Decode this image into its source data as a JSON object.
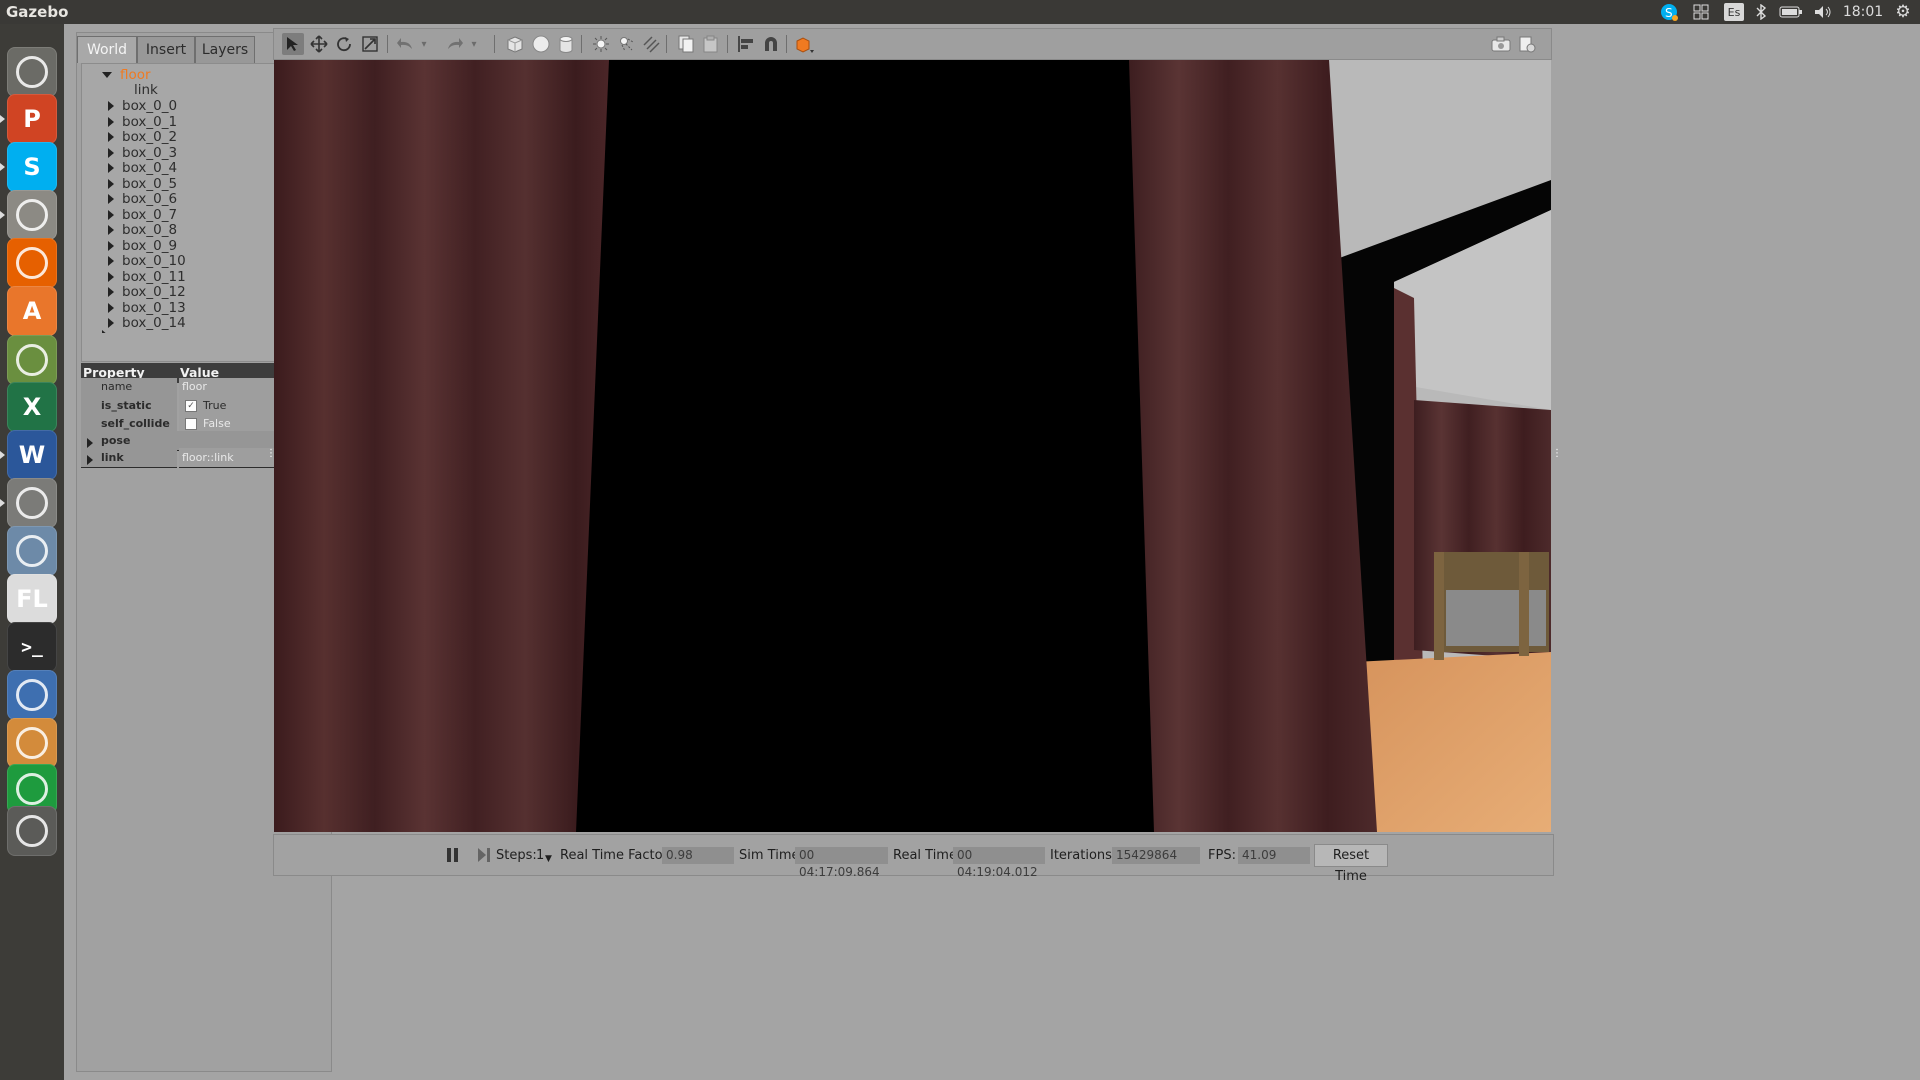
{
  "top_panel": {
    "title": "Gazebo",
    "time": "18:01",
    "keyboard": "Es"
  },
  "launcher": {
    "items": [
      {
        "name": "Ubuntu Dash",
        "icon": "ubuntu-logo-icon",
        "color": "#6b6b66"
      },
      {
        "name": "PowerPoint",
        "icon": "P",
        "color": "#d04423"
      },
      {
        "name": "Skype",
        "icon": "S",
        "color": "#00aff0"
      },
      {
        "name": "Files",
        "icon": "files-icon",
        "color": "#8c8a84"
      },
      {
        "name": "Firefox",
        "icon": "firefox-icon",
        "color": "#e66000"
      },
      {
        "name": "Software Center",
        "icon": "A",
        "color": "#e9762b"
      },
      {
        "name": "Picasa",
        "icon": "picasa-icon",
        "color": "#6a8f3f"
      },
      {
        "name": "Excel",
        "icon": "X",
        "color": "#217346"
      },
      {
        "name": "Word",
        "icon": "W",
        "color": "#2b579a"
      },
      {
        "name": "System Settings",
        "icon": "settings-icon",
        "color": "#7b7b78"
      },
      {
        "name": "MATLAB",
        "icon": "matlab-icon",
        "color": "#6d8aa8"
      },
      {
        "name": "Fluid Editor",
        "icon": "FL",
        "color": "#dcdcdc"
      },
      {
        "name": "Terminal",
        "icon": ">_",
        "color": "#2c2c2c"
      },
      {
        "name": "Media Player",
        "icon": "play-icon",
        "color": "#3e6fb0"
      },
      {
        "name": "Gazebo",
        "icon": "gazebo-icon",
        "color": "#d38b3b"
      },
      {
        "name": "Calc",
        "icon": "calc-icon",
        "color": "#1e9b3e"
      },
      {
        "name": "Stack",
        "icon": "stack-icon",
        "color": "#5b5b58"
      }
    ]
  },
  "tabs": [
    "World",
    "Insert",
    "Layers"
  ],
  "tree": {
    "root": "floor",
    "child": "link",
    "items": [
      "box_0_0",
      "box_0_1",
      "box_0_2",
      "box_0_3",
      "box_0_4",
      "box_0_5",
      "box_0_6",
      "box_0_7",
      "box_0_8",
      "box_0_9",
      "box_0_10",
      "box_0_11",
      "box_0_12",
      "box_0_13",
      "box_0_14"
    ]
  },
  "properties": {
    "header_property": "Property",
    "header_value": "Value",
    "rows": [
      {
        "key": "name",
        "value": "floor"
      },
      {
        "key": "is_static",
        "value": "True",
        "checked": true
      },
      {
        "key": "self_collide",
        "value": "False",
        "checked": false
      },
      {
        "key": "pose",
        "value": ""
      },
      {
        "key": "link",
        "value": "floor::link"
      }
    ]
  },
  "bottom": {
    "steps_label": "Steps:",
    "steps_value": "1",
    "rtf_label": "Real Time Factor:",
    "rtf_value": "0.98",
    "sim_label": "Sim Time:",
    "sim_value": "00 04:17:09.864",
    "real_label": "Real Time:",
    "real_value": "00 04:19:04.012",
    "iter_label": "Iterations:",
    "iter_value": "15429864",
    "fps_label": "FPS:",
    "fps_value": "41.09",
    "reset_label": "Reset Time"
  },
  "colors": {
    "curtain": "#4a2426",
    "accent": "#f07a21",
    "floor_wood": "#d9945a"
  }
}
